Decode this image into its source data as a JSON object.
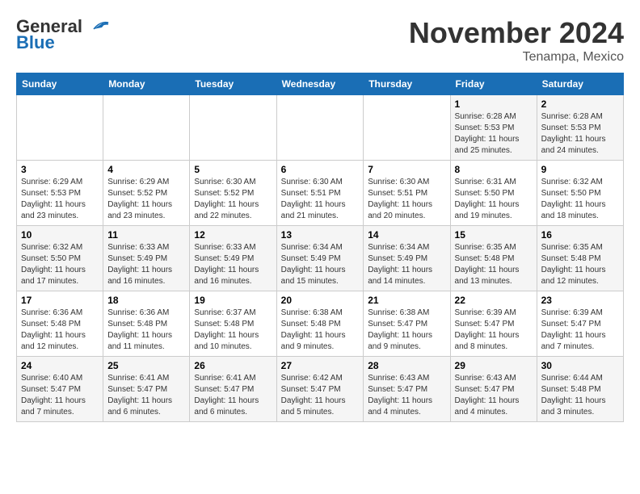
{
  "header": {
    "logo_line1": "General",
    "logo_line2": "Blue",
    "month": "November 2024",
    "location": "Tenampa, Mexico"
  },
  "weekdays": [
    "Sunday",
    "Monday",
    "Tuesday",
    "Wednesday",
    "Thursday",
    "Friday",
    "Saturday"
  ],
  "weeks": [
    [
      {
        "day": "",
        "info": ""
      },
      {
        "day": "",
        "info": ""
      },
      {
        "day": "",
        "info": ""
      },
      {
        "day": "",
        "info": ""
      },
      {
        "day": "",
        "info": ""
      },
      {
        "day": "1",
        "info": "Sunrise: 6:28 AM\nSunset: 5:53 PM\nDaylight: 11 hours and 25 minutes."
      },
      {
        "day": "2",
        "info": "Sunrise: 6:28 AM\nSunset: 5:53 PM\nDaylight: 11 hours and 24 minutes."
      }
    ],
    [
      {
        "day": "3",
        "info": "Sunrise: 6:29 AM\nSunset: 5:53 PM\nDaylight: 11 hours and 23 minutes."
      },
      {
        "day": "4",
        "info": "Sunrise: 6:29 AM\nSunset: 5:52 PM\nDaylight: 11 hours and 23 minutes."
      },
      {
        "day": "5",
        "info": "Sunrise: 6:30 AM\nSunset: 5:52 PM\nDaylight: 11 hours and 22 minutes."
      },
      {
        "day": "6",
        "info": "Sunrise: 6:30 AM\nSunset: 5:51 PM\nDaylight: 11 hours and 21 minutes."
      },
      {
        "day": "7",
        "info": "Sunrise: 6:30 AM\nSunset: 5:51 PM\nDaylight: 11 hours and 20 minutes."
      },
      {
        "day": "8",
        "info": "Sunrise: 6:31 AM\nSunset: 5:50 PM\nDaylight: 11 hours and 19 minutes."
      },
      {
        "day": "9",
        "info": "Sunrise: 6:32 AM\nSunset: 5:50 PM\nDaylight: 11 hours and 18 minutes."
      }
    ],
    [
      {
        "day": "10",
        "info": "Sunrise: 6:32 AM\nSunset: 5:50 PM\nDaylight: 11 hours and 17 minutes."
      },
      {
        "day": "11",
        "info": "Sunrise: 6:33 AM\nSunset: 5:49 PM\nDaylight: 11 hours and 16 minutes."
      },
      {
        "day": "12",
        "info": "Sunrise: 6:33 AM\nSunset: 5:49 PM\nDaylight: 11 hours and 16 minutes."
      },
      {
        "day": "13",
        "info": "Sunrise: 6:34 AM\nSunset: 5:49 PM\nDaylight: 11 hours and 15 minutes."
      },
      {
        "day": "14",
        "info": "Sunrise: 6:34 AM\nSunset: 5:49 PM\nDaylight: 11 hours and 14 minutes."
      },
      {
        "day": "15",
        "info": "Sunrise: 6:35 AM\nSunset: 5:48 PM\nDaylight: 11 hours and 13 minutes."
      },
      {
        "day": "16",
        "info": "Sunrise: 6:35 AM\nSunset: 5:48 PM\nDaylight: 11 hours and 12 minutes."
      }
    ],
    [
      {
        "day": "17",
        "info": "Sunrise: 6:36 AM\nSunset: 5:48 PM\nDaylight: 11 hours and 12 minutes."
      },
      {
        "day": "18",
        "info": "Sunrise: 6:36 AM\nSunset: 5:48 PM\nDaylight: 11 hours and 11 minutes."
      },
      {
        "day": "19",
        "info": "Sunrise: 6:37 AM\nSunset: 5:48 PM\nDaylight: 11 hours and 10 minutes."
      },
      {
        "day": "20",
        "info": "Sunrise: 6:38 AM\nSunset: 5:48 PM\nDaylight: 11 hours and 9 minutes."
      },
      {
        "day": "21",
        "info": "Sunrise: 6:38 AM\nSunset: 5:47 PM\nDaylight: 11 hours and 9 minutes."
      },
      {
        "day": "22",
        "info": "Sunrise: 6:39 AM\nSunset: 5:47 PM\nDaylight: 11 hours and 8 minutes."
      },
      {
        "day": "23",
        "info": "Sunrise: 6:39 AM\nSunset: 5:47 PM\nDaylight: 11 hours and 7 minutes."
      }
    ],
    [
      {
        "day": "24",
        "info": "Sunrise: 6:40 AM\nSunset: 5:47 PM\nDaylight: 11 hours and 7 minutes."
      },
      {
        "day": "25",
        "info": "Sunrise: 6:41 AM\nSunset: 5:47 PM\nDaylight: 11 hours and 6 minutes."
      },
      {
        "day": "26",
        "info": "Sunrise: 6:41 AM\nSunset: 5:47 PM\nDaylight: 11 hours and 6 minutes."
      },
      {
        "day": "27",
        "info": "Sunrise: 6:42 AM\nSunset: 5:47 PM\nDaylight: 11 hours and 5 minutes."
      },
      {
        "day": "28",
        "info": "Sunrise: 6:43 AM\nSunset: 5:47 PM\nDaylight: 11 hours and 4 minutes."
      },
      {
        "day": "29",
        "info": "Sunrise: 6:43 AM\nSunset: 5:47 PM\nDaylight: 11 hours and 4 minutes."
      },
      {
        "day": "30",
        "info": "Sunrise: 6:44 AM\nSunset: 5:48 PM\nDaylight: 11 hours and 3 minutes."
      }
    ]
  ]
}
